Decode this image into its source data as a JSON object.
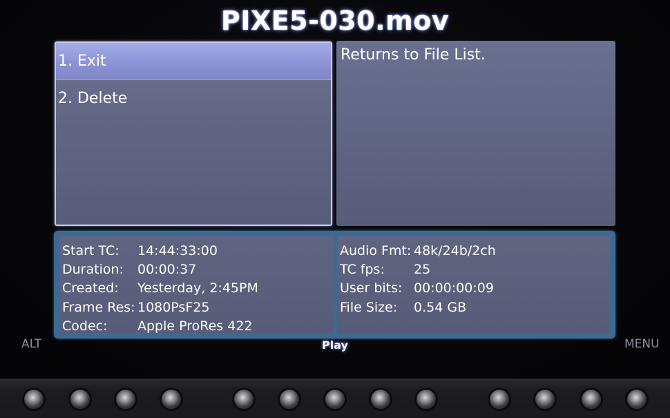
{
  "title": "PIXE5-030.mov",
  "menu": {
    "items": [
      {
        "label": "1. Exit"
      },
      {
        "label": "2. Delete"
      }
    ],
    "selected_index": 0
  },
  "description": "Returns to File List.",
  "info": {
    "left": [
      {
        "key": "Start TC:",
        "value": "14:44:33:00"
      },
      {
        "key": "Duration:",
        "value": "00:00:37"
      },
      {
        "key": "Created:",
        "value": "Yesterday, 2:45PM"
      },
      {
        "key": "Frame Res:",
        "value": "1080PsF25"
      },
      {
        "key": "Codec:",
        "value": "Apple ProRes 422"
      }
    ],
    "right": [
      {
        "key": "Audio Fmt:",
        "value": "48k/24b/2ch"
      },
      {
        "key": "TC fps:",
        "value": "25"
      },
      {
        "key": "User bits:",
        "value": "00:00:00:09"
      },
      {
        "key": "File Size:",
        "value": "0.54 GB"
      }
    ]
  },
  "softkeys": {
    "alt": "ALT",
    "center": "Play",
    "menu": "MENU"
  },
  "colors": {
    "panel": "#5f6583",
    "selected": "#8c94d6",
    "info_frame": "#3d6a92",
    "background": "#050508"
  }
}
